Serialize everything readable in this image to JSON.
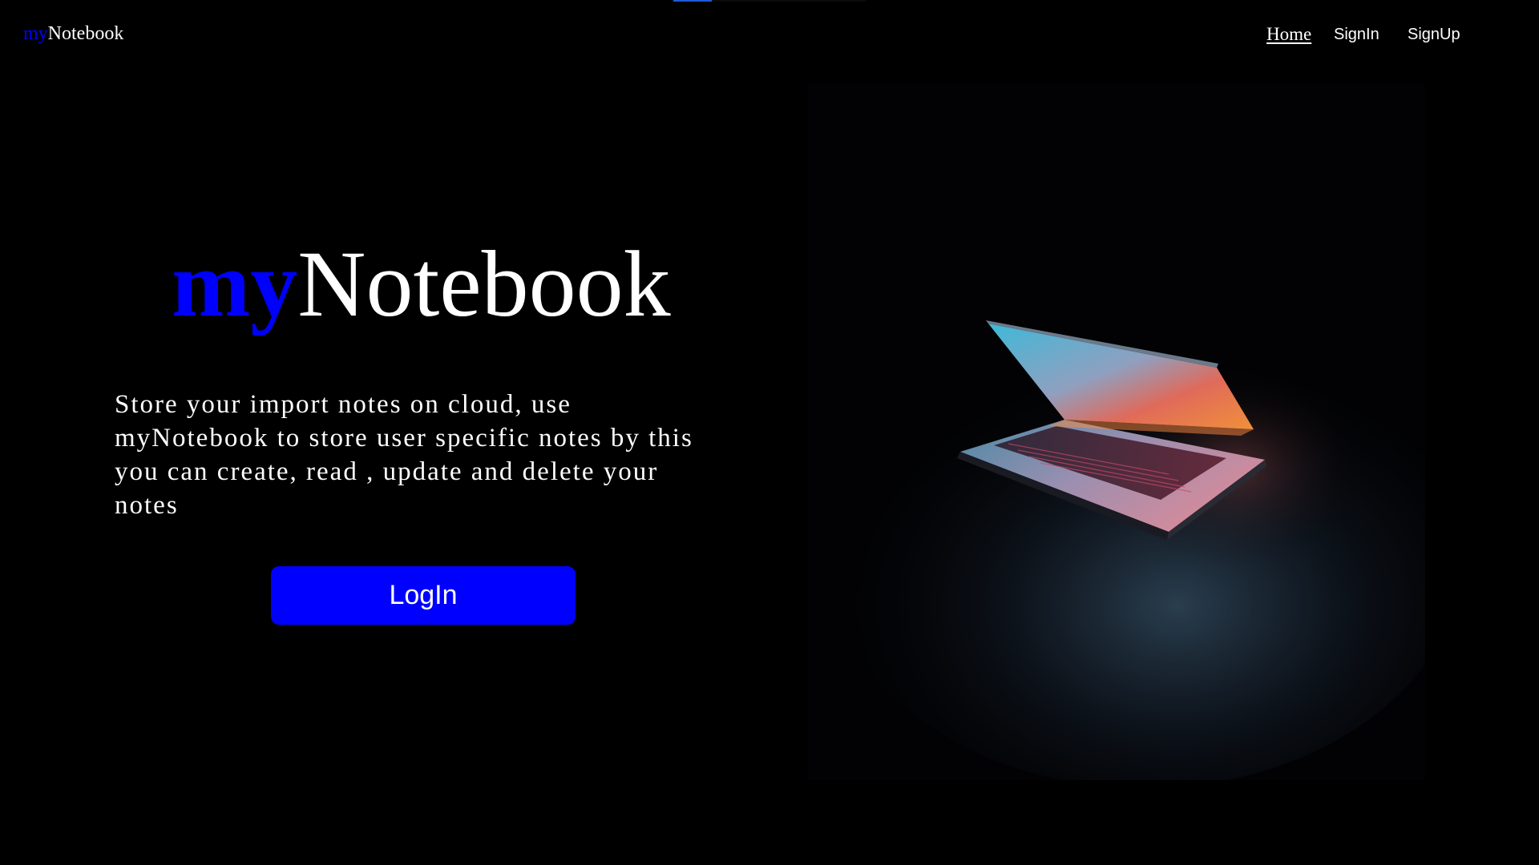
{
  "navbar": {
    "brand_prefix": "my",
    "brand_suffix": "Notebook",
    "links": [
      {
        "label": "Home"
      },
      {
        "label": "SignIn"
      },
      {
        "label": "SignUp"
      }
    ]
  },
  "hero": {
    "title_prefix": "my",
    "title_suffix": "Notebook",
    "description": "Store your import notes on cloud, use myNotebook to store user specific notes by this you can create, read , update and delete your notes",
    "login_button": "LogIn",
    "image_icon": "laptop-photo"
  },
  "colors": {
    "background": "#000000",
    "accent": "#0000ff",
    "text": "#ffffff"
  }
}
